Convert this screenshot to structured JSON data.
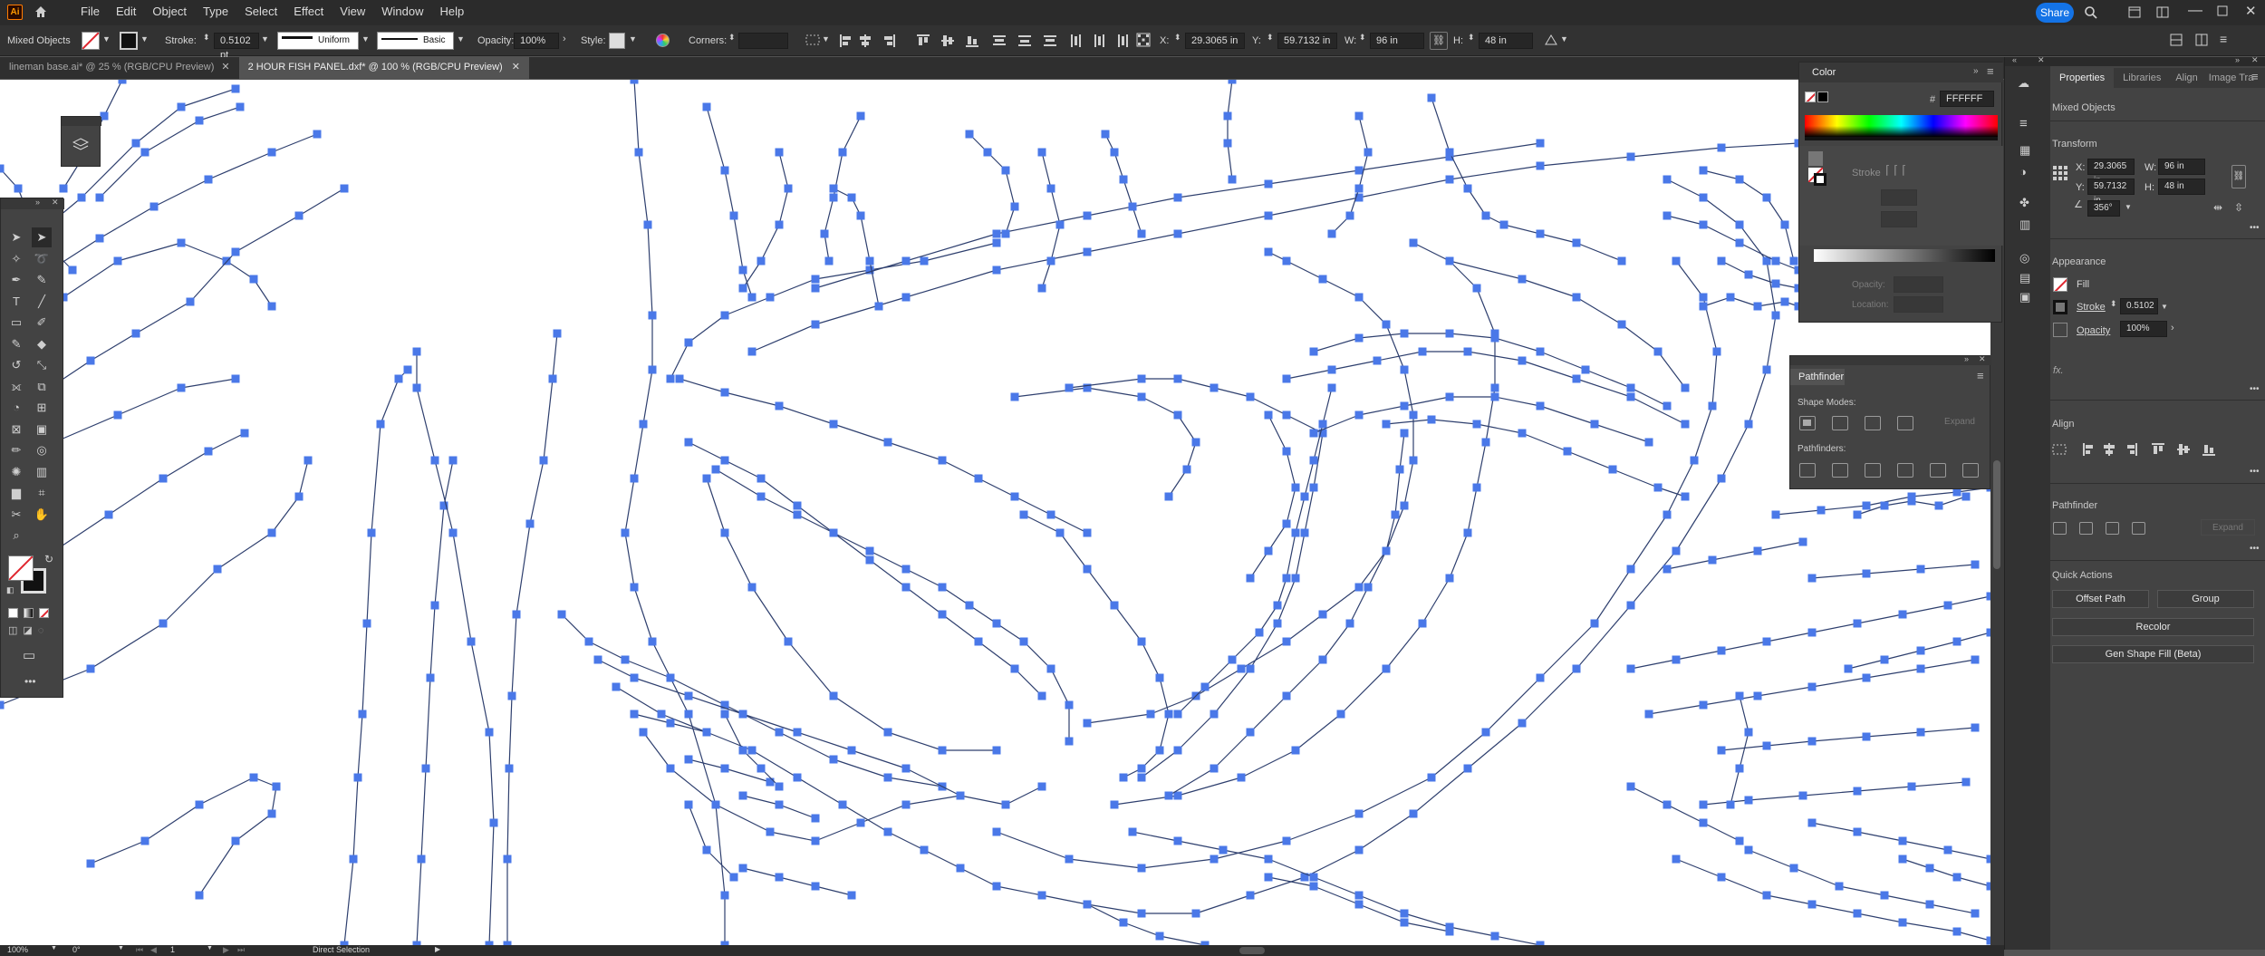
{
  "app": {
    "logo": "Ai",
    "share_label": "Share"
  },
  "menu": [
    "File",
    "Edit",
    "Object",
    "Type",
    "Select",
    "Effect",
    "View",
    "Window",
    "Help"
  ],
  "control_bar": {
    "selection_label": "Mixed Objects",
    "stroke_label": "Stroke:",
    "stroke_value": "0.5102 pt",
    "profile_label": "Uniform",
    "brush_label": "Basic",
    "opacity_label": "Opacity:",
    "opacity_value": "100%",
    "style_label": "Style:",
    "corners_label": "Corners:",
    "x_label": "X:",
    "x_value": "29.3065 in",
    "y_label": "Y:",
    "y_value": "59.7132 in",
    "w_label": "W:",
    "w_value": "96 in",
    "h_label": "H:",
    "h_value": "48 in"
  },
  "doc_tabs": [
    {
      "label": "lineman base.ai* @ 25 % (RGB/CPU Preview)",
      "active": false
    },
    {
      "label": "2 HOUR FISH PANEL.dxf* @ 100 % (RGB/CPU Preview)",
      "active": true
    }
  ],
  "color_panel": {
    "title": "Color",
    "hex": "FFFFFF",
    "stroke_label": "Stroke",
    "opacity_label": "Opacity:",
    "location_label": "Location:"
  },
  "pathfinder_panel": {
    "title": "Pathfinder",
    "shape_modes_label": "Shape Modes:",
    "expand_label": "Expand",
    "pathfinders_label": "Pathfinders:"
  },
  "properties_panel": {
    "tabs": [
      "Properties",
      "Libraries",
      "Align",
      "Image Tra"
    ],
    "selection_label": "Mixed Objects",
    "transform_title": "Transform",
    "x_label": "X:",
    "x_value": "29.3065 in",
    "y_label": "Y:",
    "y_value": "59.7132 in",
    "w_label": "W:",
    "w_value": "96 in",
    "h_label": "H:",
    "h_value": "48 in",
    "rotate_value": "356°",
    "appearance_title": "Appearance",
    "fill_label": "Fill",
    "stroke_label": "Stroke",
    "stroke_value": "0.5102",
    "opacity_label": "Opacity",
    "opacity_value": "100%",
    "fx_label": "fx.",
    "align_title": "Align",
    "pathfinder_title": "Pathfinder",
    "pathfinder_expand": "Expand",
    "quick_actions_title": "Quick Actions",
    "offset_path_label": "Offset Path",
    "group_label": "Group",
    "recolor_label": "Recolor",
    "gen_shape_fill_label": "Gen Shape Fill (Beta)"
  },
  "status_bar": {
    "zoom": "100%",
    "rotation": "0°",
    "artboard": "1",
    "tool": "Direct Selection"
  },
  "colors": {
    "accent": "#1473e6",
    "anchor": "#4a78e8",
    "path": "#2e3f6e"
  }
}
